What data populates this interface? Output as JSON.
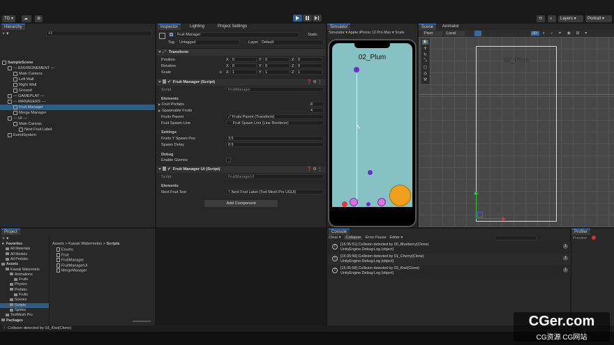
{
  "toolbar": {
    "account": "TG",
    "layers": "Layers",
    "layout": "Portrait"
  },
  "hierarchy": {
    "tab": "Hierarchy",
    "search_placeholder": "All",
    "items": [
      {
        "label": "SampleScene",
        "depth": 0
      },
      {
        "label": "--- ENVIRONEMENT ---",
        "depth": 1
      },
      {
        "label": "Main Camera",
        "depth": 2
      },
      {
        "label": "Left Wall",
        "depth": 2
      },
      {
        "label": "Right Wall",
        "depth": 2
      },
      {
        "label": "Ground",
        "depth": 2
      },
      {
        "label": "--- GAMEPLAY ---",
        "depth": 1
      },
      {
        "label": "--- MANAGERS ---",
        "depth": 1
      },
      {
        "label": "Fruit Manager",
        "depth": 2
      },
      {
        "label": "Merge Manager",
        "depth": 2
      },
      {
        "label": "--- UI ---",
        "depth": 1
      },
      {
        "label": "Main Canvas",
        "depth": 2
      },
      {
        "label": "Next Fruit Label",
        "depth": 3
      },
      {
        "label": "EventSystem",
        "depth": 1
      }
    ]
  },
  "inspector": {
    "tabs": [
      "Inspector",
      "Lighting",
      "Project Settings"
    ],
    "object_name": "Fruit Manager",
    "static_label": "Static",
    "tag_label": "Tag",
    "tag_value": "Untagged",
    "layer_label": "Layer",
    "layer_value": "Default",
    "transform": {
      "title": "Transform",
      "position_label": "Position",
      "rotation_label": "Rotation",
      "scale_label": "Scale",
      "position": [
        "0",
        "0",
        "0"
      ],
      "rotation": [
        "0",
        "0",
        "0"
      ],
      "scale": [
        "1",
        "1",
        "1"
      ],
      "axis_x": "X",
      "axis_y": "Y",
      "axis_z": "Z"
    },
    "fruit_manager": {
      "title": "Fruit Manager (Script)",
      "script_label": "Script",
      "script_value": "FruitManager",
      "elements_header": "Elements",
      "fruit_prefabs_label": "Fruit Prefabs",
      "fruit_prefabs_count": "8",
      "spawnable_label": "Spawnable Fruits",
      "spawnable_count": "4",
      "fruits_parent_label": "Fruits Parent",
      "fruits_parent_value": "Fruits Parent (Transform)",
      "spawn_line_label": "Fruit Spawn Line",
      "spawn_line_value": "Fruit Spawn Line (Line Renderer)",
      "settings_header": "Settings",
      "spawn_pos_label": "Fruits Y Spawn Pos",
      "spawn_pos_value": "3.5",
      "spawn_delay_label": "Spawn Delay",
      "spawn_delay_value": "0.5",
      "debug_header": "Debug",
      "gizmos_label": "Enable Gizmos"
    },
    "fruit_manager_ui": {
      "title": "Fruit Manager UI (Script)",
      "script_label": "Script",
      "script_value": "FruitManagerUI",
      "elements_header": "Elements",
      "next_label": "Next Fruit Text",
      "next_value": "Next Fruit Label (Text Mesh Pro UGUI)"
    },
    "add_component": "Add Component"
  },
  "simulator": {
    "tab": "Simulator",
    "mode": "Simulator",
    "device": "Apple iPhone 12 Pro Max",
    "scale_label": "Scale",
    "phone_label": "02_Plum"
  },
  "scene": {
    "tabs": [
      "Scene",
      "Animator"
    ],
    "pivot": "Pivot",
    "local": "Local",
    "mode_2d": "2D",
    "label": "02_Plum"
  },
  "project": {
    "tab": "Project",
    "tree": [
      {
        "label": "Favorites",
        "depth": 0
      },
      {
        "label": "All Materials",
        "depth": 1
      },
      {
        "label": "All Models",
        "depth": 1
      },
      {
        "label": "All Prefabs",
        "depth": 1
      },
      {
        "label": "Assets",
        "depth": 0
      },
      {
        "label": "Kawaii Watermeln",
        "depth": 1
      },
      {
        "label": "Animations",
        "depth": 2
      },
      {
        "label": "Fruits",
        "depth": 3
      },
      {
        "label": "Physics",
        "depth": 2
      },
      {
        "label": "Prefabs",
        "depth": 2
      },
      {
        "label": "Fruits",
        "depth": 3
      },
      {
        "label": "Scenes",
        "depth": 2
      },
      {
        "label": "Scripts",
        "depth": 2
      },
      {
        "label": "Sprites",
        "depth": 2
      },
      {
        "label": "TextMesh Pro",
        "depth": 1
      },
      {
        "label": "Packages",
        "depth": 0
      }
    ],
    "breadcrumb": [
      "Assets",
      "Kawaii Watermelon",
      "Scripts"
    ],
    "files": [
      "Enums",
      "Fruit",
      "FruitManager",
      "FruitManagerUI",
      "MergeManager"
    ]
  },
  "console": {
    "tab": "Console",
    "clear": "Clear",
    "collapse": "Collapse",
    "error_pause": "Error Pause",
    "editor": "Editor",
    "logs": [
      {
        "line1": "[15:35:51] Collision detected by 00_Blueberry(Clone)",
        "line2": "UnityEngine.Debug:Log (object)",
        "count": "1"
      },
      {
        "line1": "[15:35:56] Collision detected by 01_Cherry(Clone)",
        "line2": "UnityEngine.Debug:Log (object)",
        "count": "1"
      },
      {
        "line1": "[15:35:58] Collision detected by 03_Kiwi(Clone)",
        "line2": "UnityEngine.Debug:Log (object)",
        "count": "1"
      }
    ]
  },
  "profiler": {
    "tab": "Profiler",
    "preview": "Preview"
  },
  "status_bar": "Collision detected by 03_Kiwi(Clone)",
  "watermark": {
    "main": "CGer.com",
    "sub": "CG资源 CG网站"
  },
  "colors": {
    "accent": "#4b87d8",
    "selection": "#2c5d87",
    "game_bg": "#86c1c4",
    "ball_purple": "#6a2fc7",
    "ball_pink": "#d872e0",
    "ball_red": "#e23a3a",
    "ball_orange": "#f0a01c"
  }
}
